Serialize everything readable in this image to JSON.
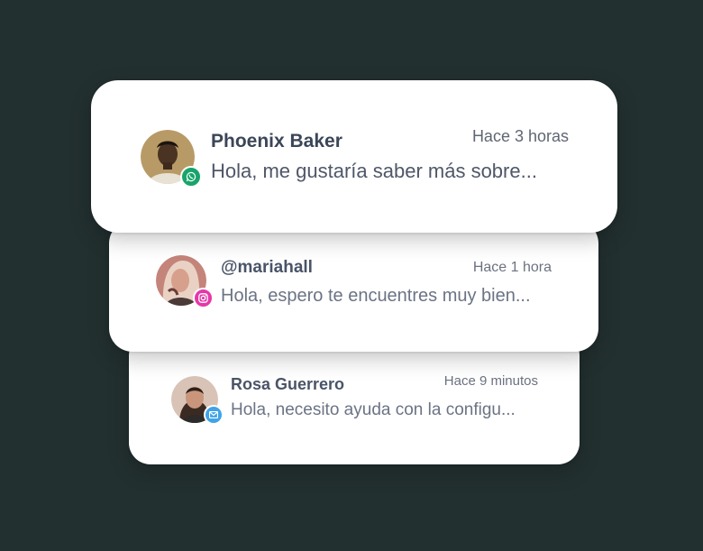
{
  "conversations": [
    {
      "name": "Phoenix Baker",
      "time": "Hace 3 horas",
      "message": "Hola, me gustaría saber más sobre...",
      "channel_icon": "whatsapp-icon",
      "channel_color": "#18a46a"
    },
    {
      "name": "@mariahall",
      "time": "Hace 1 hora",
      "message": "Hola, espero te encuentres muy bien...",
      "channel_icon": "instagram-icon",
      "channel_color": "#e637a8"
    },
    {
      "name": "Rosa Guerrero",
      "time": "Hace 9 minutos",
      "message": "Hola, necesito ayuda con la configu...",
      "channel_icon": "email-icon",
      "channel_color": "#3fa3e8"
    }
  ],
  "colors": {
    "background": "#233030",
    "card": "#ffffff"
  }
}
